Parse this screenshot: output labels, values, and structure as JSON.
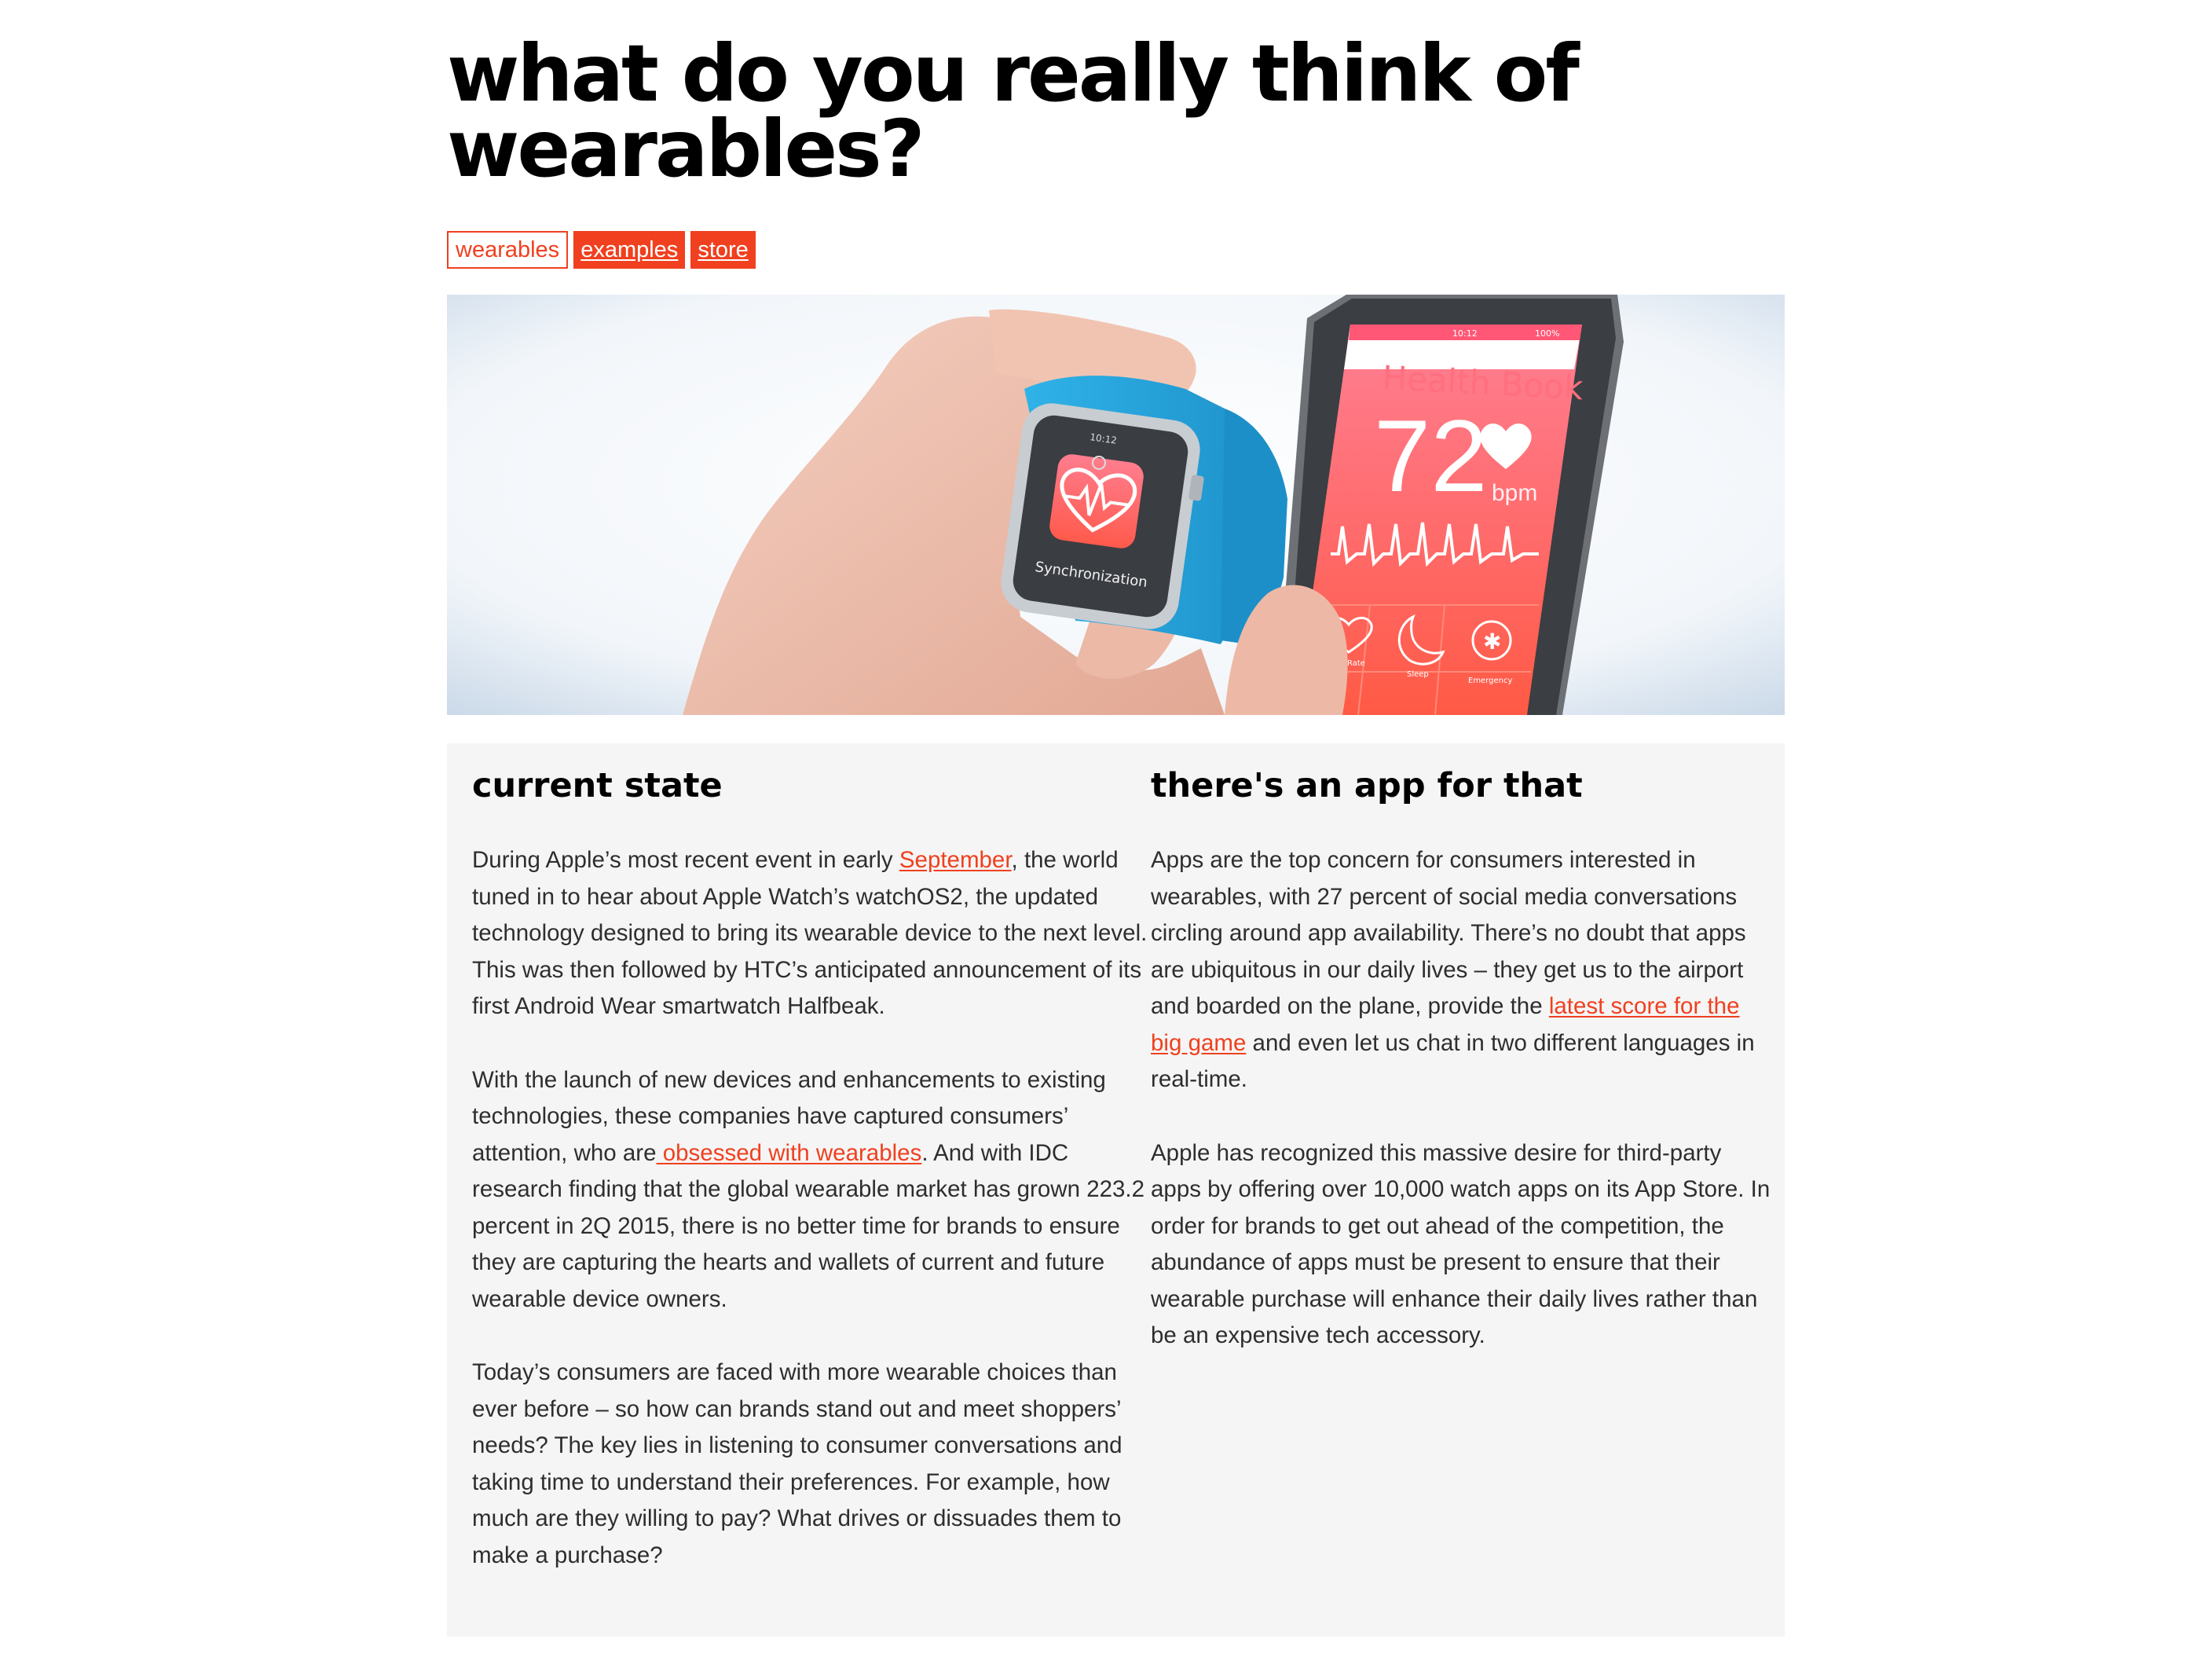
{
  "article": {
    "title": "what do you really think of wearables?",
    "tags": [
      {
        "label": "wearables"
      },
      {
        "label": "examples"
      },
      {
        "label": "store"
      }
    ]
  },
  "hero": {
    "phone_app_title": "Health Book",
    "phone_bpm_value": "72",
    "phone_bpm_unit": "bpm",
    "phone_time": "10:12",
    "phone_battery": "100%",
    "phone_tiles": [
      "Heart Rate",
      "Sleep",
      "Emergency"
    ],
    "watch_time": "10:12",
    "watch_caption": "Synchronization"
  },
  "left_column": {
    "heading": "current state",
    "p1": {
      "before_link": "During Apple’s most recent event in early ",
      "link": "September",
      "after_link": ", the world tuned in to hear about Apple Watch’s watchOS2, the updated technology designed to bring its wearable device to the next level. This was then followed by HTC’s anticipated announcement of its first Android Wear smartwatch Halfbeak."
    },
    "p2": {
      "before_link": "With the launch of new devices and enhancements to existing technologies, these companies have captured consumers’ attention, who are",
      "link": " obsessed with wearables",
      "after_link": ". And with IDC research finding that the global wearable market has grown 223.2 percent in 2Q 2015, there is no better time for brands to ensure they are capturing the hearts and wallets of current and future wearable device owners."
    },
    "p3": "Today’s consumers are faced with more wearable choices than ever before – so how can brands stand out and meet shoppers’ needs? The key lies in listening to consumer conversations and taking time to understand their preferences. For example, how much are they willing to pay? What drives or dissuades them to make a purchase?"
  },
  "right_column": {
    "heading": "there's an app for that",
    "p1": {
      "before_link": "Apps are the top concern for consumers interested in wearables, with 27 percent of social media conversations circling around app availability. There’s no doubt that apps are ubiquitous in our daily lives – they get us to the airport and boarded on the plane, provide the ",
      "link": "latest score for the big game",
      "after_link": " and even let us chat in two different languages in real-time."
    },
    "p2": "Apple has recognized this massive desire for third-party apps by offering over 10,000 watch apps on its App Store. In order for brands to get out ahead of the competition, the abundance of apps must be present to ensure that their wearable purchase will enhance their daily lives rather than be an expensive tech accessory."
  },
  "colors": {
    "accent": "#f0401f",
    "panel_background": "#f5f5f5",
    "watch_band": "#27a8e0",
    "health_gradient_top": "#ff7788",
    "health_gradient_bottom": "#ff5c49"
  }
}
